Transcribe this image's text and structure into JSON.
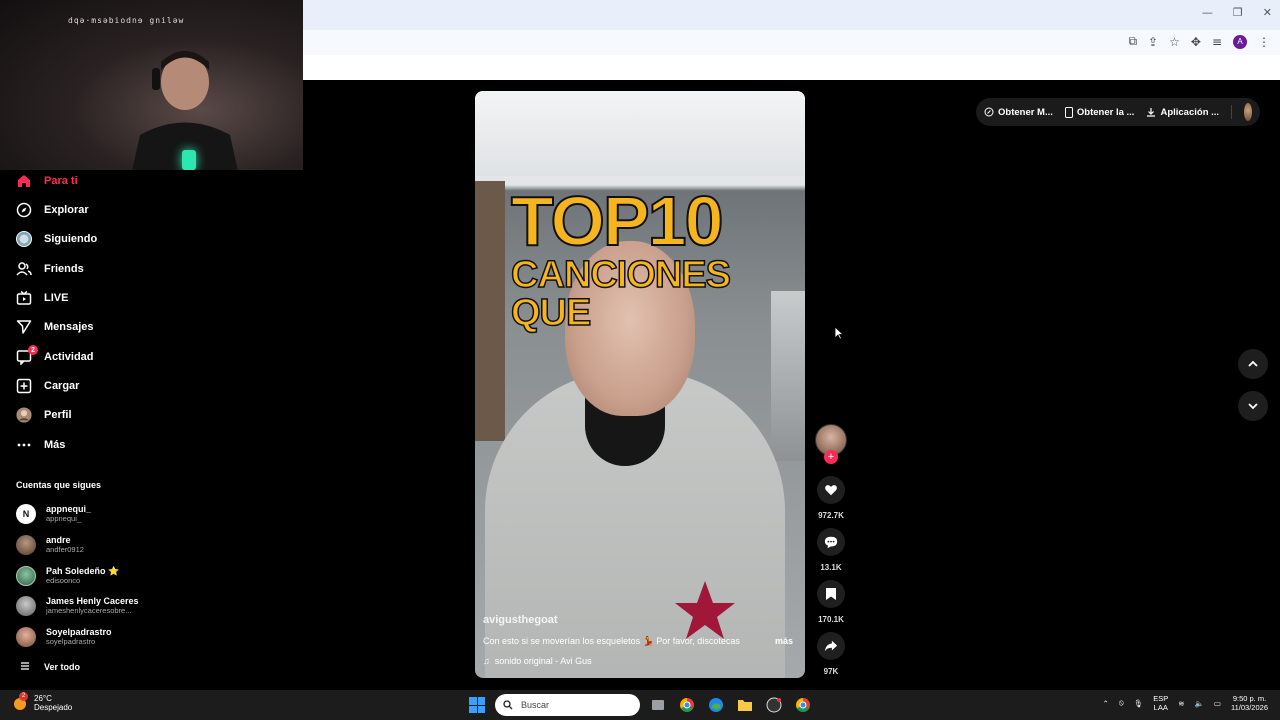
{
  "webcam": {
    "watermark": "dqə·msəbiodnɘ gniləw"
  },
  "sidebar": {
    "items": [
      {
        "label": "Para ti",
        "icon": "home-icon",
        "active": true
      },
      {
        "label": "Explorar",
        "icon": "compass-icon"
      },
      {
        "label": "Siguiendo",
        "icon": "following-avatar-icon"
      },
      {
        "label": "Friends",
        "icon": "friends-icon"
      },
      {
        "label": "LIVE",
        "icon": "live-tv-icon"
      },
      {
        "label": "Mensajes",
        "icon": "send-icon"
      },
      {
        "label": "Actividad",
        "icon": "activity-icon",
        "badge": "2"
      },
      {
        "label": "Cargar",
        "icon": "upload-plus-icon"
      },
      {
        "label": "Perfil",
        "icon": "profile-avatar-icon"
      },
      {
        "label": "Más",
        "icon": "more-dots-icon"
      }
    ],
    "following_title": "Cuentas que sigues",
    "accounts": [
      {
        "name": "appnequi_",
        "handle": "appnequi_",
        "avatar_color": "#ffffff"
      },
      {
        "name": "andre",
        "handle": "andfer0912",
        "avatar_color": "#6b5546"
      },
      {
        "name": "Pah Soledeño ⭐",
        "handle": "edisoonco",
        "avatar_color": "#3a6b4f"
      },
      {
        "name": "James Henly Caceres",
        "handle": "jameshenlycaceresobre...",
        "avatar_color": "#8a8a8a"
      },
      {
        "name": "Soyelpadrastro",
        "handle": "soyelpadrastro",
        "avatar_color": "#9b6b5a"
      }
    ],
    "see_all": "Ver todo"
  },
  "top_actions": {
    "get_coins": "Obtener M...",
    "get_app": "Obtener la ...",
    "desktop_app": "Aplicación ..."
  },
  "video": {
    "overlay_line1": "TOP10",
    "overlay_line2": "CANCIONES",
    "overlay_line3": "QUE",
    "author": "avigusthegoat",
    "caption": "Con esto si se moverían los esqueletos 💃 Por favor, discotecas",
    "more": "más",
    "sound": "sonido original - Avi Gus"
  },
  "rail": {
    "likes": "972.7K",
    "comments": "13.1K",
    "saves": "170.1K",
    "shares": "97K"
  },
  "taskbar": {
    "temperature": "26°C",
    "weather": "Despejado",
    "weather_badge": "2",
    "search_placeholder": "Buscar",
    "lang_1": "ESP",
    "lang_2": "LAA",
    "time": "9:50 p. m.",
    "date": "11/03/2026"
  },
  "colors": {
    "accent": "#fe2c55",
    "overlay_text": "#f6b51e"
  }
}
